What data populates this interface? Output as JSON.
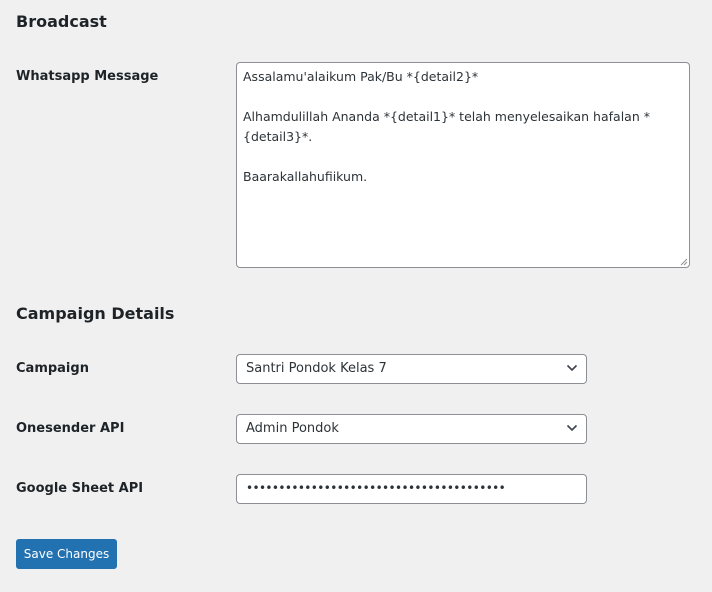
{
  "broadcast": {
    "title": "Broadcast",
    "whatsapp_message": {
      "label": "Whatsapp Message",
      "lines": [
        "Assalamu'alaikum Pak/Bu *{detail2}*",
        "",
        "Alhamdulillah Ananda *{detail1}* telah menyelesaikan hafalan *",
        "{detail3}*.",
        "",
        "Baarakallahufiikum."
      ]
    }
  },
  "campaign_details": {
    "title": "Campaign Details",
    "campaign": {
      "label": "Campaign",
      "selected": "Santri Pondok Kelas 7"
    },
    "onesender_api": {
      "label": "Onesender API",
      "selected": "Admin Pondok"
    },
    "google_sheet_api": {
      "label": "Google Sheet API",
      "masked_value": "••••••••••••••••••••••••••••••••••••••••"
    }
  },
  "actions": {
    "save_label": "Save Changes"
  },
  "icons": {
    "select_chevron": "chevron-down-icon",
    "textarea_resize": "resize-grip-icon"
  },
  "colors": {
    "page_background": "#f0f0f1",
    "primary_button": "#2271b1",
    "input_border": "#8c8f94"
  }
}
